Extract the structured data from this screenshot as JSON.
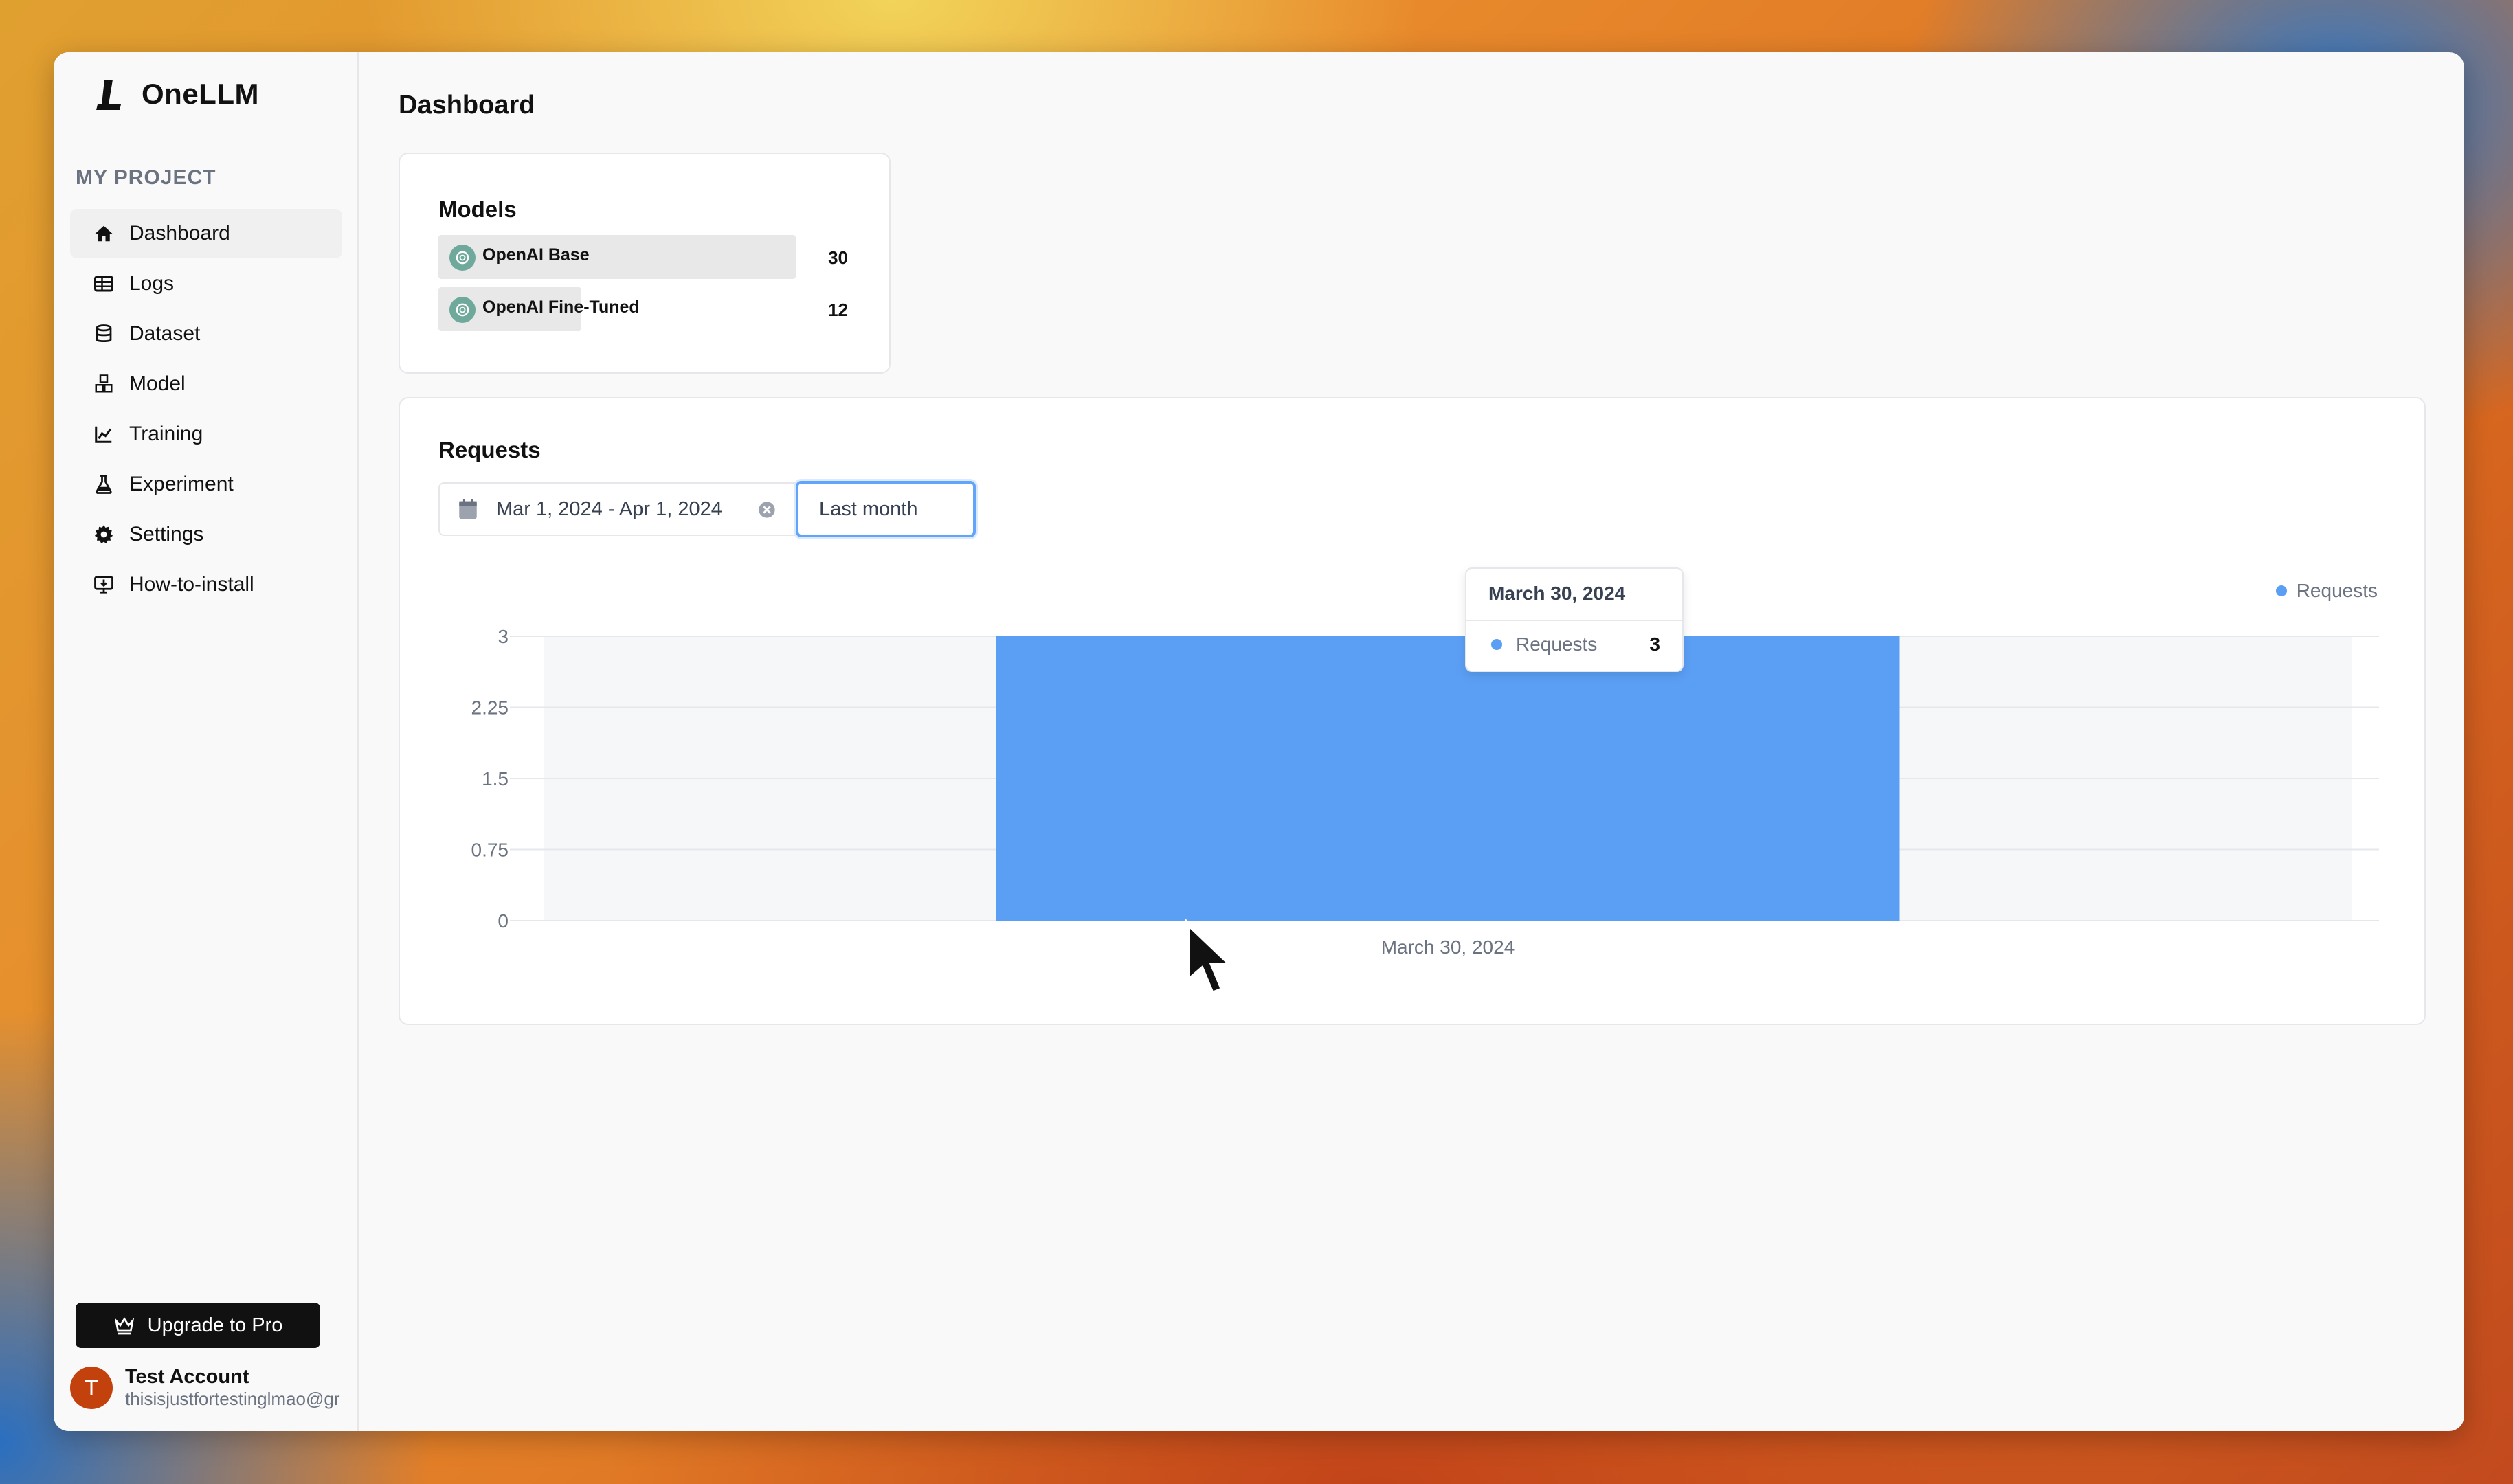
{
  "app": {
    "name": "OneLLM"
  },
  "sidebar": {
    "section_label": "MY PROJECT",
    "items": [
      {
        "label": "Dashboard",
        "icon": "home-icon",
        "active": true
      },
      {
        "label": "Logs",
        "icon": "table-icon"
      },
      {
        "label": "Dataset",
        "icon": "database-icon"
      },
      {
        "label": "Model",
        "icon": "cubes-icon"
      },
      {
        "label": "Training",
        "icon": "chart-icon"
      },
      {
        "label": "Experiment",
        "icon": "flask-icon"
      },
      {
        "label": "Settings",
        "icon": "gear-icon"
      },
      {
        "label": "How-to-install",
        "icon": "monitor-download-icon"
      }
    ],
    "upgrade_label": "Upgrade to Pro",
    "account": {
      "initial": "T",
      "name": "Test Account",
      "email": "thisisjustfortestinglmao@gr"
    }
  },
  "page": {
    "title": "Dashboard"
  },
  "models_card": {
    "title": "Models",
    "rows": [
      {
        "name": "OpenAI Base",
        "count": 30
      },
      {
        "name": "OpenAI Fine-Tuned",
        "count": 12
      }
    ]
  },
  "requests_card": {
    "title": "Requests",
    "date_range": "Mar 1, 2024 - Apr 1, 2024",
    "preset": "Last month",
    "tooltip": {
      "date": "March 30, 2024",
      "series": "Requests",
      "value": "3"
    }
  },
  "colors": {
    "bar": "#5b9ff5",
    "accent_focus": "#60a5fa",
    "avatar": "#c2410c"
  },
  "chart_data": {
    "type": "bar",
    "categories": [
      "March 30, 2024"
    ],
    "series": [
      {
        "name": "Requests",
        "values": [
          3
        ]
      }
    ],
    "ylim": [
      0,
      3
    ],
    "yticks": [
      "0",
      "0.75",
      "1.5",
      "2.25",
      "3"
    ],
    "grid": true,
    "legend": "top-right"
  }
}
